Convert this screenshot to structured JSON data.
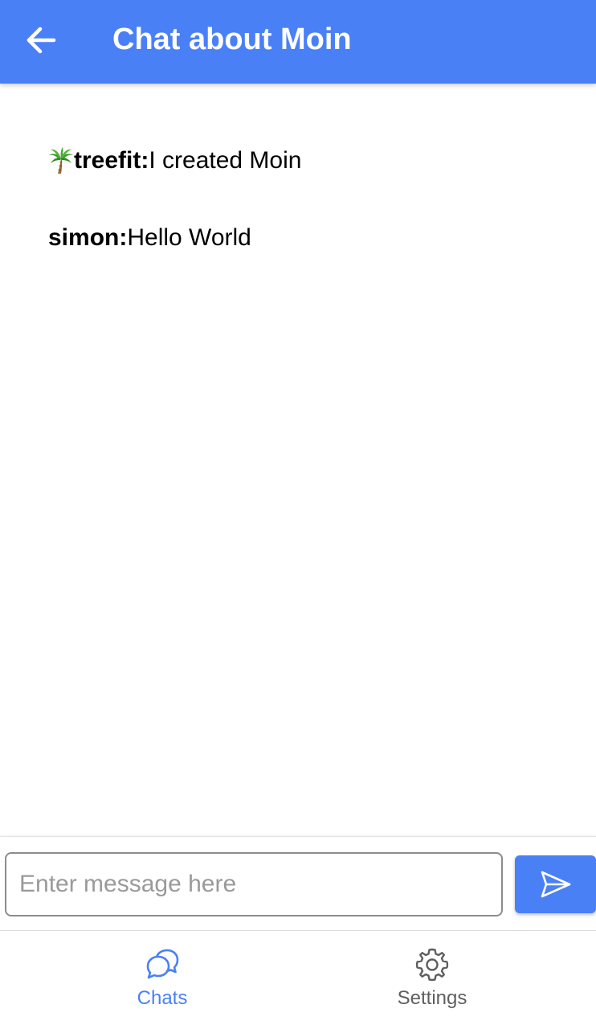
{
  "header": {
    "title": "Chat about Moin",
    "back_icon": "arrow-left-icon"
  },
  "messages": [
    {
      "emoji": "palm-tree-icon",
      "author": "treefit:",
      "text": "I created Moin"
    },
    {
      "emoji": null,
      "author": "simon:",
      "text": "Hello World"
    }
  ],
  "composer": {
    "value": "",
    "placeholder": "Enter message here",
    "send_icon": "send-icon"
  },
  "tabs": [
    {
      "label": "Chats",
      "icon": "chat-bubbles-icon",
      "active": true
    },
    {
      "label": "Settings",
      "icon": "gear-icon",
      "active": false
    }
  ],
  "colors": {
    "primary": "#4a80f5",
    "inactive_tab": "#5f5f5f",
    "text": "#000000"
  }
}
